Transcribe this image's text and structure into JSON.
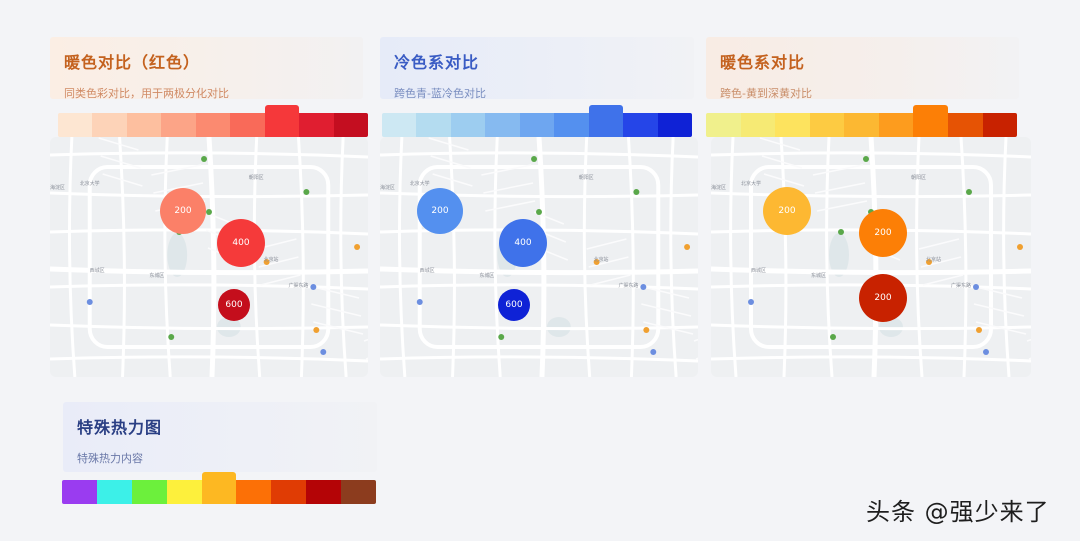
{
  "cards": {
    "warm": {
      "title": "暖色对比（红色）",
      "subtitle": "同类色彩对比，用于两极分化对比",
      "scale": [
        "#fde6d2",
        "#fdd3b8",
        "#fdbf9f",
        "#fca487",
        "#fb8a70",
        "#f96a59",
        "#f5383a",
        "#e01e30",
        "#c40e20"
      ],
      "highlight": 6,
      "bubbles": [
        {
          "label": "200",
          "color": "#fb8068"
        },
        {
          "label": "400",
          "color": "#f53a3a"
        },
        {
          "label": "600",
          "color": "#c40e1c"
        }
      ]
    },
    "cool": {
      "title": "冷色系对比",
      "subtitle": "跨色青-蓝冷色对比",
      "scale": [
        "#cde8f3",
        "#b4dcf0",
        "#9dcdf0",
        "#86baf0",
        "#6ea6f0",
        "#5490ef",
        "#3f72ea",
        "#2545e8",
        "#0f22d6"
      ],
      "highlight": 6,
      "bubbles": [
        {
          "label": "200",
          "color": "#5490ef"
        },
        {
          "label": "400",
          "color": "#3f72ea"
        },
        {
          "label": "600",
          "color": "#0f22d6"
        }
      ]
    },
    "warm2": {
      "title": "暖色系对比",
      "subtitle": "跨色-黄到深黄对比",
      "scale": [
        "#f0f08c",
        "#f6ea74",
        "#fde35e",
        "#fdcb42",
        "#fcb832",
        "#fd9c1e",
        "#fc7f06",
        "#e65304",
        "#c82200"
      ],
      "highlight": 6,
      "bubbles": [
        {
          "label": "200",
          "color": "#fdb832"
        },
        {
          "label": "200",
          "color": "#fc7f06"
        },
        {
          "label": "200",
          "color": "#c82200"
        }
      ]
    },
    "special": {
      "title": "特殊热力图",
      "subtitle": "特殊热力内容",
      "scale": [
        "#9a3cf0",
        "#3cf0e8",
        "#6cf03c",
        "#fdf03c",
        "#fdb822",
        "#fc7006",
        "#e03c04",
        "#b40406",
        "#8c3c1e"
      ],
      "highlight": 4
    }
  },
  "map_labels": [
    "海淀区",
    "朝阳区",
    "西城区",
    "东城区",
    "广渠东路",
    "北京大学",
    "北京站"
  ],
  "watermark": "头条 @强少来了"
}
